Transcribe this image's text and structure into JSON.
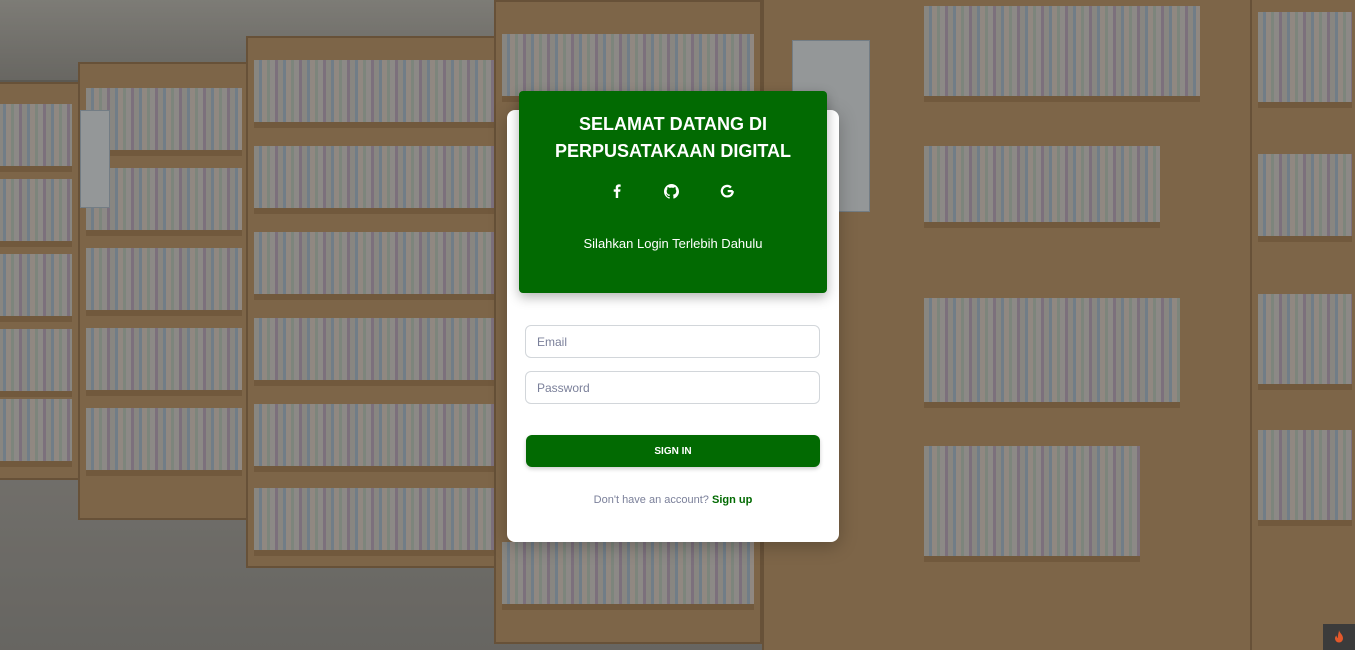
{
  "header": {
    "title_line1": "SELAMAT DATANG DI",
    "title_line2": "PERPUSATAKAAN DIGITAL",
    "subtitle": "Silahkan Login Terlebih Dahulu",
    "socials": [
      "facebook-icon",
      "github-icon",
      "google-icon"
    ]
  },
  "form": {
    "email_placeholder": "Email",
    "email_value": "",
    "password_placeholder": "Password",
    "password_value": "",
    "signin_label": "SIGN IN"
  },
  "footer": {
    "prompt": "Don't have an account?",
    "signup_label": "Sign up"
  },
  "colors": {
    "primary": "#026a02",
    "card": "#ffffff",
    "muted_text": "#7b809a"
  },
  "corner_badge": "flame-icon"
}
